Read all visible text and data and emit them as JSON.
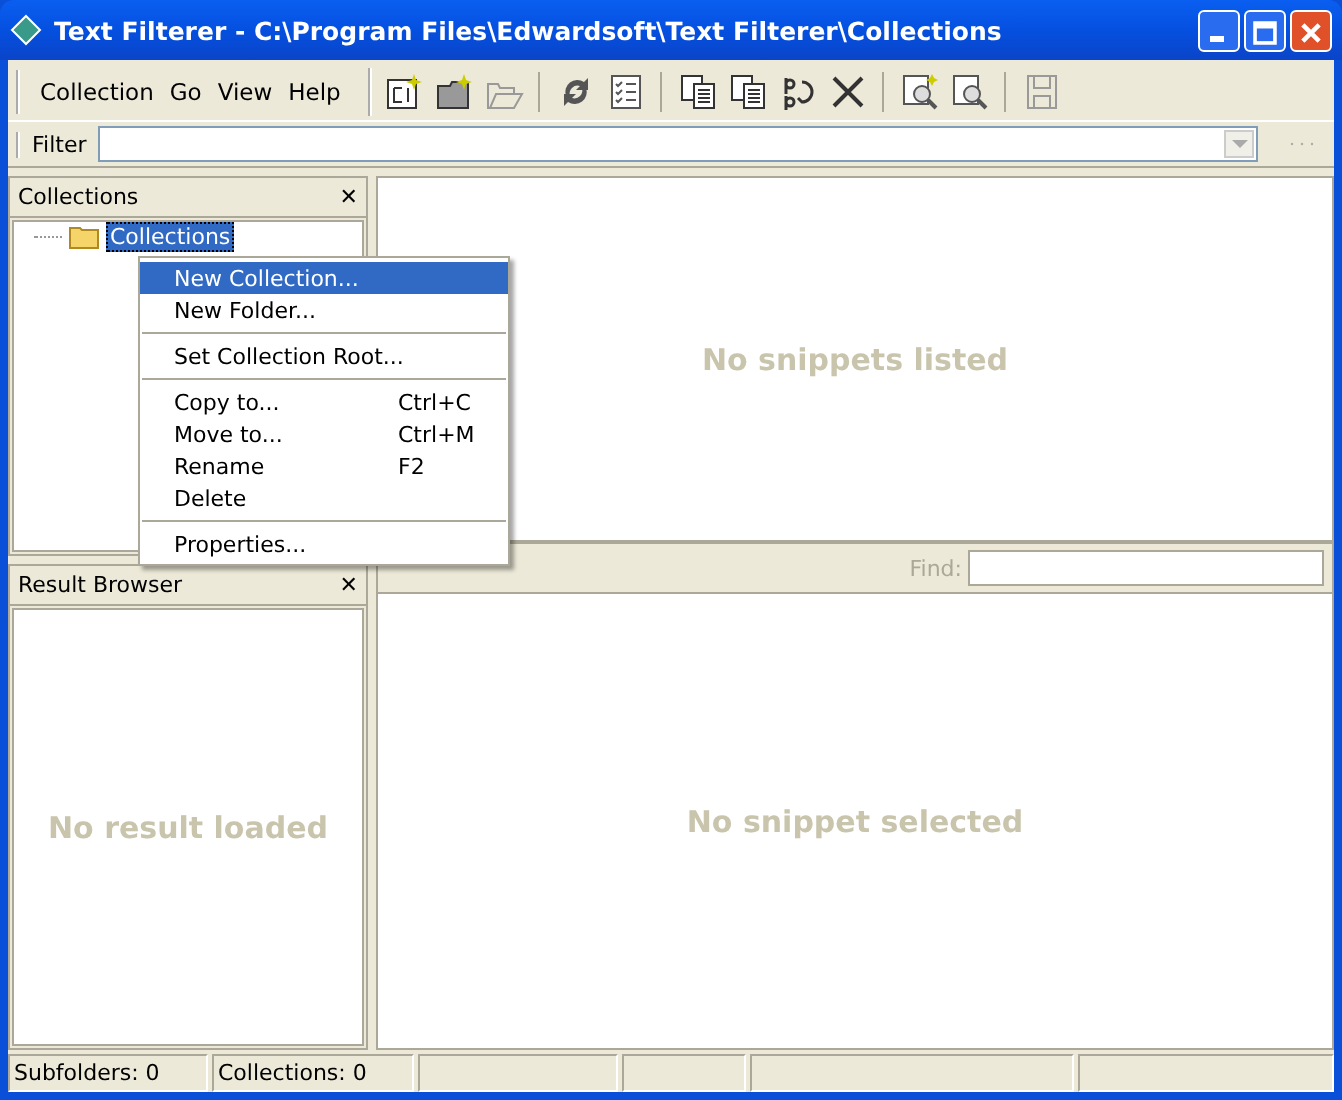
{
  "window": {
    "title": "Text Filterer - C:\\Program Files\\Edwardsoft\\Text Filterer\\Collections"
  },
  "menu": [
    "Collection",
    "Go",
    "View",
    "Help"
  ],
  "filter": {
    "label": "Filter"
  },
  "collections_panel": {
    "title": "Collections",
    "close": "✕",
    "tree": [
      {
        "label": "Collections",
        "selected": true
      }
    ]
  },
  "context_menu": [
    {
      "kind": "item",
      "label": "New Collection...",
      "selected": true
    },
    {
      "kind": "item",
      "label": "New Folder...",
      "selected": false
    },
    {
      "kind": "separator"
    },
    {
      "kind": "item",
      "label": "Set Collection Root...",
      "selected": false
    },
    {
      "kind": "separator"
    },
    {
      "kind": "item",
      "label": "Copy to...",
      "shortcut": "Ctrl+C",
      "selected": false
    },
    {
      "kind": "item",
      "label": "Move to...",
      "shortcut": "Ctrl+M",
      "selected": false
    },
    {
      "kind": "item",
      "label": "Rename",
      "shortcut": "F2",
      "selected": false
    },
    {
      "kind": "item",
      "label": "Delete",
      "selected": false
    },
    {
      "kind": "separator"
    },
    {
      "kind": "item",
      "label": "Properties...",
      "selected": false
    }
  ],
  "result_panel": {
    "title": "Result Browser",
    "close": "✕",
    "empty_text": "No result loaded"
  },
  "snippets_list": {
    "empty_text": "No snippets listed"
  },
  "find": {
    "label": "Find:",
    "disabled": true
  },
  "snippet_view": {
    "empty_text": "No snippet selected"
  },
  "status_bar": [
    "Subfolders: 0",
    "Collections: 0"
  ]
}
